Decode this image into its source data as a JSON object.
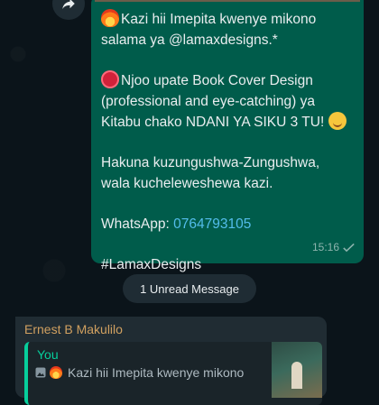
{
  "outgoing_message": {
    "line1": "Kazi hii Imepita kwenye mikono",
    "line2": "salama ya @lamaxdesigns.*",
    "line3": "Njoo upate Book Cover  Design",
    "line4": "(professional and eye-catching) ya",
    "line5": "Kitabu chako NDANI YA SIKU 3 TU!",
    "line6": "Hakuna kuzungushwa-Zungushwa,",
    "line7": "wala kucheleweshewa kazi.",
    "whatsapp_label": "WhatsApp: ",
    "phone": "0764793105",
    "hashtag": "#LamaxDesigns",
    "time": "15:16",
    "status_icon": "single-check-icon"
  },
  "unread_banner": "1 Unread Message",
  "incoming_message": {
    "sender": "Ernest B Makulilo",
    "quote_author": "You",
    "quote_text": "Kazi hii Imepita kwenye mikono"
  },
  "colors": {
    "outgoing_bubble": "#005c4b",
    "incoming_bubble": "#202c33",
    "link": "#53bdeb",
    "quote_accent": "#06cf9c",
    "sender_name": "#d0a060"
  }
}
